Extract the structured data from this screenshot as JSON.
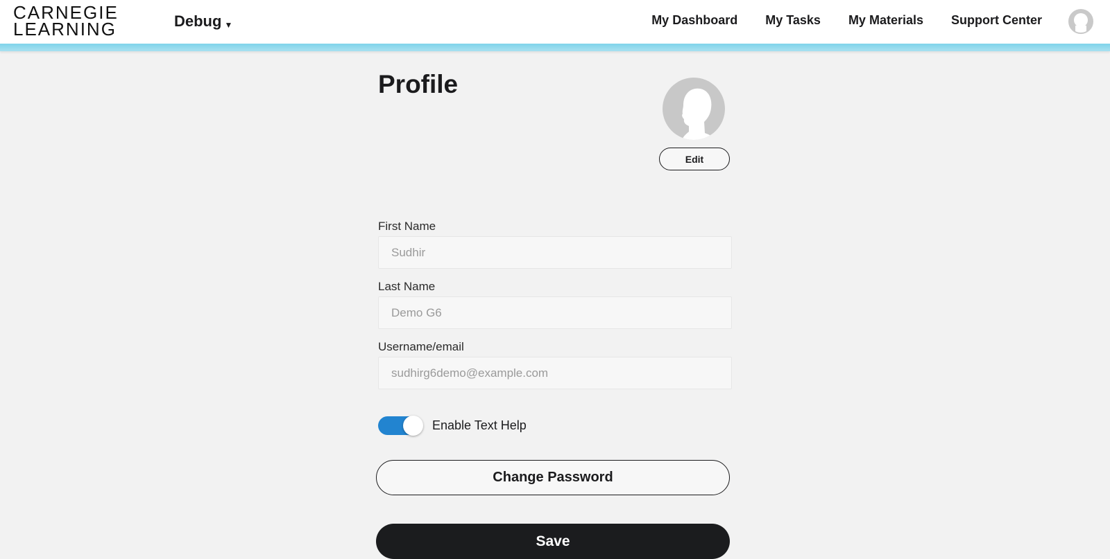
{
  "header": {
    "logo_line1": "CARNEGIE",
    "logo_line2": "LEARNING",
    "debug_label": "Debug",
    "nav": [
      "My Dashboard",
      "My Tasks",
      "My Materials",
      "Support Center"
    ]
  },
  "profile": {
    "title": "Profile",
    "edit_label": "Edit",
    "fields": [
      {
        "label": "First Name",
        "value": "Sudhir"
      },
      {
        "label": "Last Name",
        "value": "Demo G6"
      },
      {
        "label": "Username/email",
        "value": "sudhirg6demo@example.com"
      }
    ],
    "text_help_label": "Enable Text Help",
    "text_help_enabled": true,
    "change_password_label": "Change Password",
    "save_label": "Save"
  },
  "colors": {
    "accent_bar": "#8fd8ec",
    "toggle_on": "#2284d0",
    "save_button": "#1b1c1e",
    "page_background": "#f2f2f2"
  },
  "icons": {
    "user_menu": "user-avatar-icon",
    "profile_avatar": "person-silhouette-icon",
    "dropdown": "caret-down-icon"
  }
}
